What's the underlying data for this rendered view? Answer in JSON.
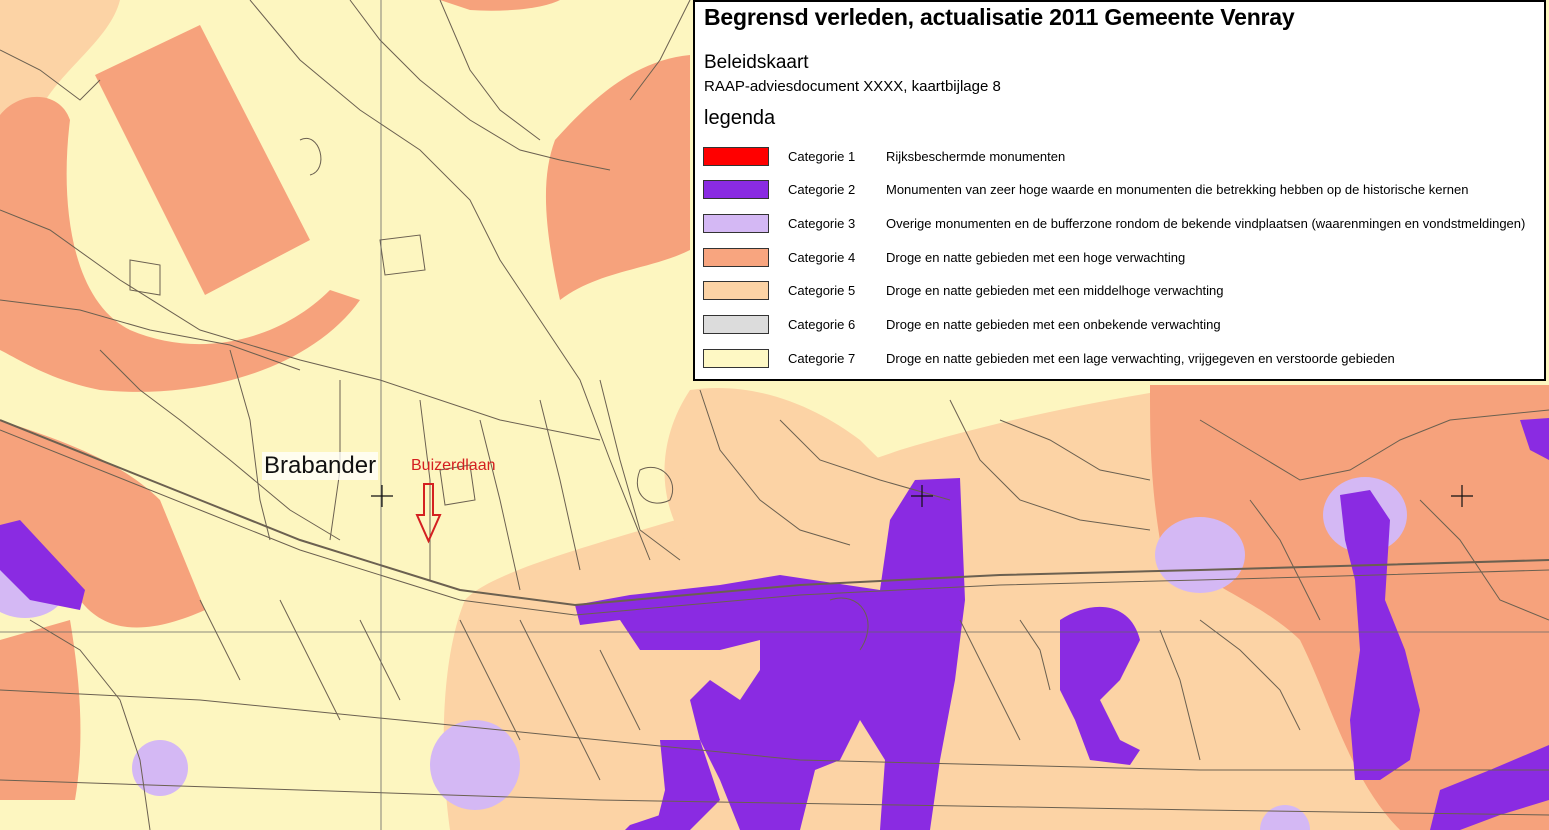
{
  "legend": {
    "title": "Begrensd verleden, actualisatie 2011  Gemeente Venray",
    "subtitle": "Beleidskaart",
    "document": "RAAP-adviesdocument XXXX, kaartbijlage 8",
    "heading": "legenda",
    "items": [
      {
        "label": "Categorie 1",
        "description": "Rijksbeschermde monumenten",
        "color": "#ff0000"
      },
      {
        "label": "Categorie 2",
        "description": "Monumenten van zeer hoge waarde en monumenten die betrekking hebben op de historische kernen",
        "color": "#8a2be2"
      },
      {
        "label": "Categorie 3",
        "description": "Overige monumenten en de bufferzone rondom de bekende vindplaatsen (waarenmingen en vondstmeldingen)",
        "color": "#d4b8f4"
      },
      {
        "label": "Categorie 4",
        "description": "Droge en natte gebieden met een hoge verwachting",
        "color": "#f8a57f"
      },
      {
        "label": "Categorie 5",
        "description": "Droge en natte gebieden met een middelhoge verwachting",
        "color": "#fcd3a5"
      },
      {
        "label": "Categorie 6",
        "description": "Droge en natte gebieden met een onbekende verwachting",
        "color": "#dcdcdc"
      },
      {
        "label": "Categorie 7",
        "description": "Droge en natte gebieden met een lage verwachting, vrijgegeven en verstoorde gebieden",
        "color": "#fef8c4"
      }
    ]
  },
  "map": {
    "place_label": "Brabander",
    "street_label": "Buizerdlaan",
    "arrow_color": "#d42020"
  }
}
